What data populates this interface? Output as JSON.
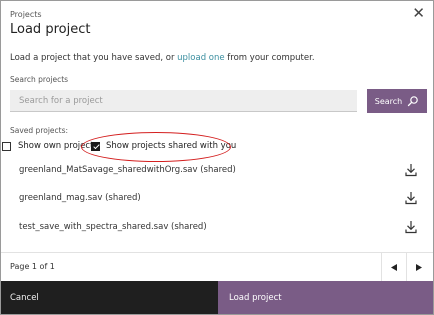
{
  "dialog": {
    "breadcrumb": "Projects",
    "title": "Load project",
    "intro_before": "Load a project that you have saved, or ",
    "intro_link": "upload one",
    "intro_after": " from your computer."
  },
  "search": {
    "label": "Search projects",
    "placeholder": "Search for a project",
    "button_label": "Search"
  },
  "saved": {
    "label": "Saved projects:",
    "filters": [
      {
        "label": "Show own projects",
        "checked": false
      },
      {
        "label": "Show projects shared with you",
        "checked": true
      }
    ],
    "files": [
      "greenland_MatSavage_sharedwithOrg.sav (shared)",
      "greenland_mag.sav (shared)",
      "test_save_with_spectra_shared.sav (shared)"
    ]
  },
  "pagination": {
    "label": "Page 1 of 1"
  },
  "footer": {
    "cancel_label": "Cancel",
    "load_label": "Load project"
  },
  "colors": {
    "accent": "#7a5c86",
    "link": "#3b8fa0",
    "footer_dark": "#1f1f1f",
    "highlight": "#d42020"
  }
}
